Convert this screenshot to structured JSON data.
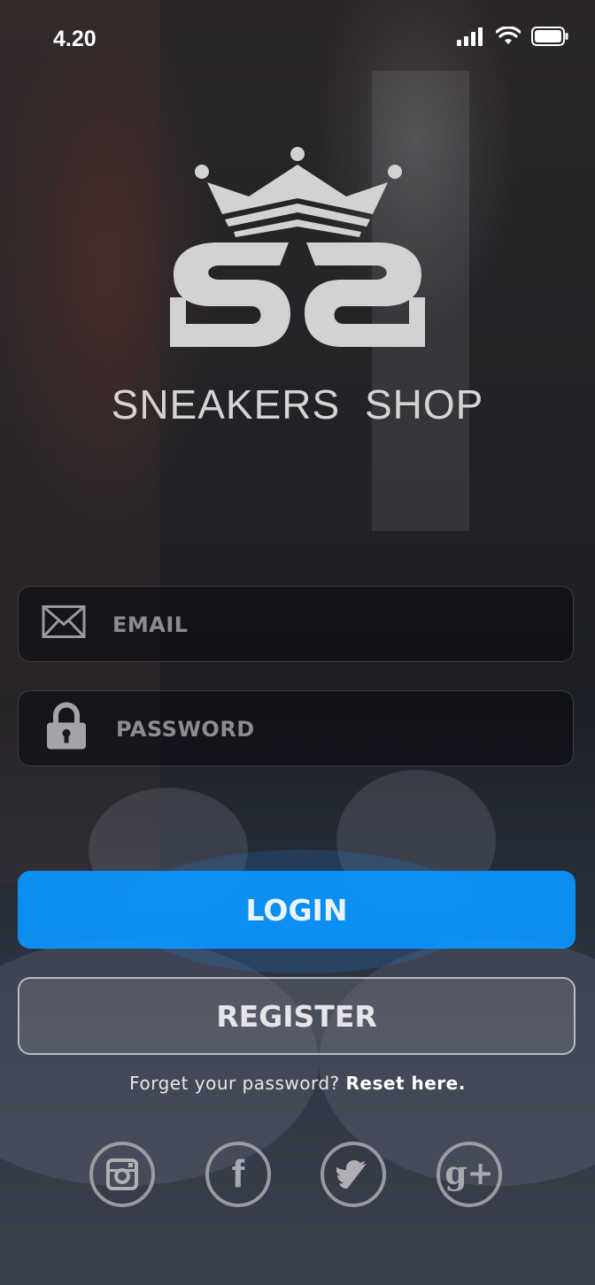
{
  "status_bar": {
    "time": "4.20"
  },
  "logo": {
    "monogram": "SS"
  },
  "brand": {
    "name": "SNEAKERS  SHOP"
  },
  "form": {
    "email": {
      "placeholder": "EMAIL",
      "value": "",
      "icon": "envelope-icon"
    },
    "password": {
      "placeholder": "PASSWORD",
      "value": "",
      "icon": "lock-icon"
    }
  },
  "buttons": {
    "login": "LOGIN",
    "register": "REGISTER"
  },
  "forgot": {
    "prefix": "Forget your password?",
    "link": "Reset here."
  },
  "social": [
    {
      "name": "instagram",
      "icon": "instagram-icon"
    },
    {
      "name": "facebook",
      "icon": "facebook-icon",
      "glyph": "f"
    },
    {
      "name": "twitter",
      "icon": "twitter-icon"
    },
    {
      "name": "google-plus",
      "icon": "google-plus-icon",
      "glyph": "g+"
    }
  ],
  "colors": {
    "accent": "#0A96FF",
    "text": "#FFFFFF",
    "logo": "#D4D4D4"
  }
}
